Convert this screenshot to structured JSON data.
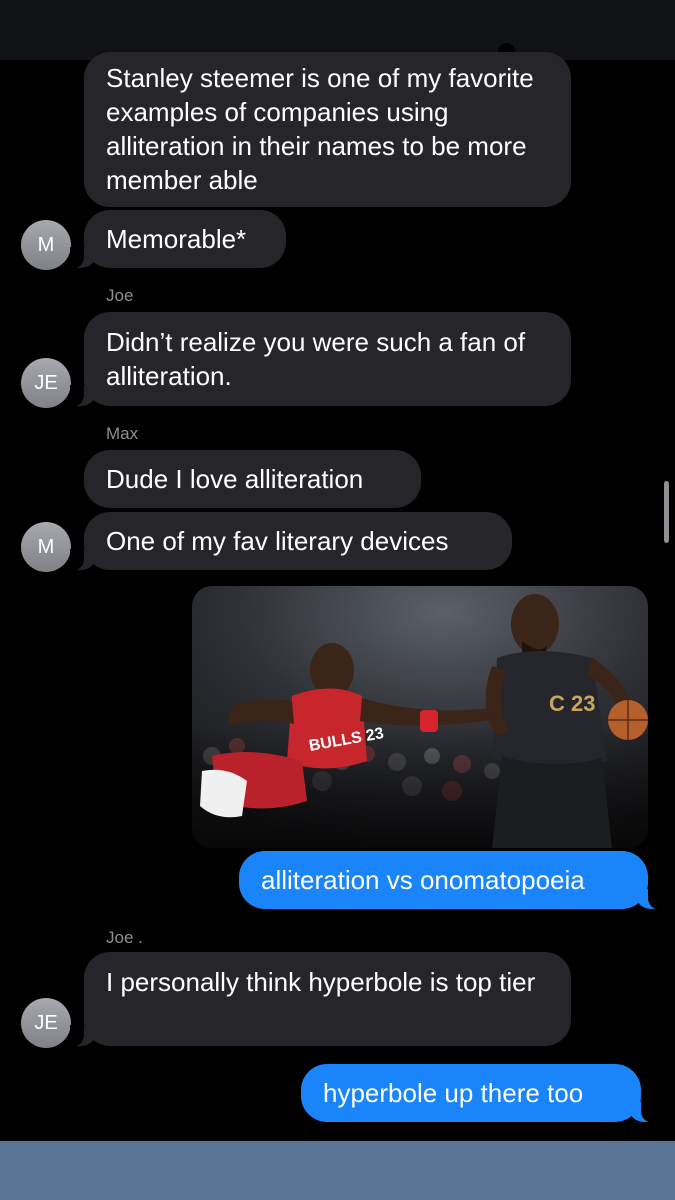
{
  "messages": [
    {
      "text": "Stanley steemer is one of my favorite examples of companies using alliteration in their names to be more member able"
    },
    {
      "text": "Memorable*",
      "avatar": "M"
    },
    {
      "sender": "Joe",
      "text": "Didn’t realize you were such a fan of alliteration.",
      "avatar": "JE"
    },
    {
      "sender": "Max",
      "text": "Dude I love alliteration"
    },
    {
      "text": "One of my fav literary devices",
      "avatar": "M"
    },
    {
      "image": "basketball-players-photo"
    },
    {
      "text": "alliteration vs onomatopoeia"
    },
    {
      "sender": "Joe .",
      "text": "I personally think hyperbole is top tier",
      "avatar": "JE"
    },
    {
      "text": "hyperbole up there too"
    }
  ],
  "photo": {
    "jersey_left": "BULLS 23",
    "jersey_right": "C 23"
  },
  "colors": {
    "incoming_bubble": "#26252a",
    "outgoing_bubble": "#1a84fb",
    "background": "#000000",
    "bottom_bar": "#5a7595"
  }
}
